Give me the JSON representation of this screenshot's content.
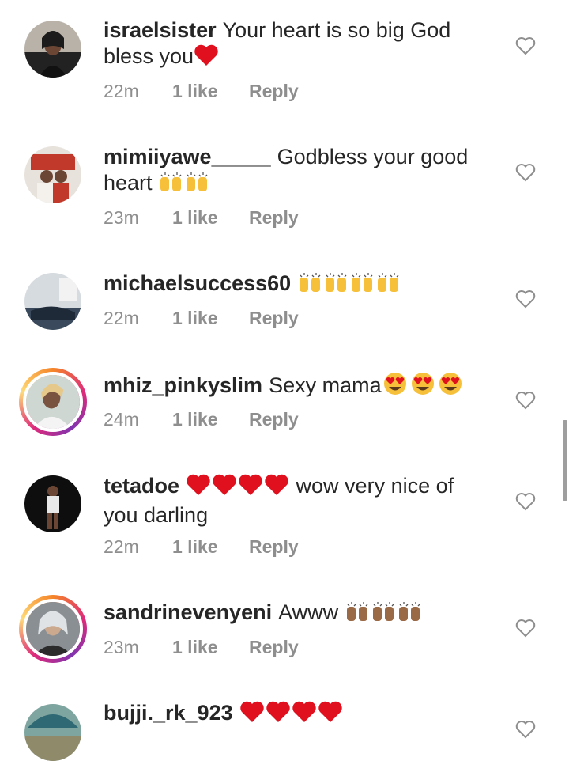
{
  "comments": [
    {
      "username": "israelsister",
      "text": "Your heart is so big God bless you",
      "emoji": [
        "red-heart"
      ],
      "time": "22m",
      "likes": "1 like",
      "reply": "Reply",
      "story": false
    },
    {
      "username": "mimiiyawe_____",
      "text": "Godbless your good heart",
      "emoji": [
        "raising-hands",
        "raising-hands"
      ],
      "time": "23m",
      "likes": "1 like",
      "reply": "Reply",
      "story": false
    },
    {
      "username": "michaelsuccess60",
      "text": "",
      "emoji": [
        "raising-hands",
        "raising-hands",
        "raising-hands",
        "raising-hands"
      ],
      "time": "22m",
      "likes": "1 like",
      "reply": "Reply",
      "story": false
    },
    {
      "username": "mhiz_pinkyslim",
      "text": "Sexy mama",
      "emoji": [
        "heart-eyes",
        "heart-eyes",
        "heart-eyes"
      ],
      "time": "24m",
      "likes": "1 like",
      "reply": "Reply",
      "story": true
    },
    {
      "username": "tetadoe",
      "text": "wow very nice of you darling",
      "emoji": [
        "red-heart",
        "red-heart",
        "red-heart",
        "red-heart"
      ],
      "time": "22m",
      "likes": "1 like",
      "reply": "Reply",
      "story": false
    },
    {
      "username": "sandrinevenyeni",
      "text": "Awww",
      "emoji": [
        "raising-hands-brown",
        "raising-hands-brown",
        "raising-hands-brown"
      ],
      "time": "23m",
      "likes": "1 like",
      "reply": "Reply",
      "story": true
    },
    {
      "username": "bujji._rk_923",
      "text": "",
      "emoji": [
        "red-heart",
        "red-heart",
        "red-heart",
        "red-heart"
      ],
      "time": "",
      "likes": "",
      "reply": "",
      "story": false
    }
  ],
  "colors": {
    "username": "#262626",
    "meta": "#8e8e8e",
    "heart_emoji": "#e0101e",
    "story_ring": "#dd2a7b"
  }
}
